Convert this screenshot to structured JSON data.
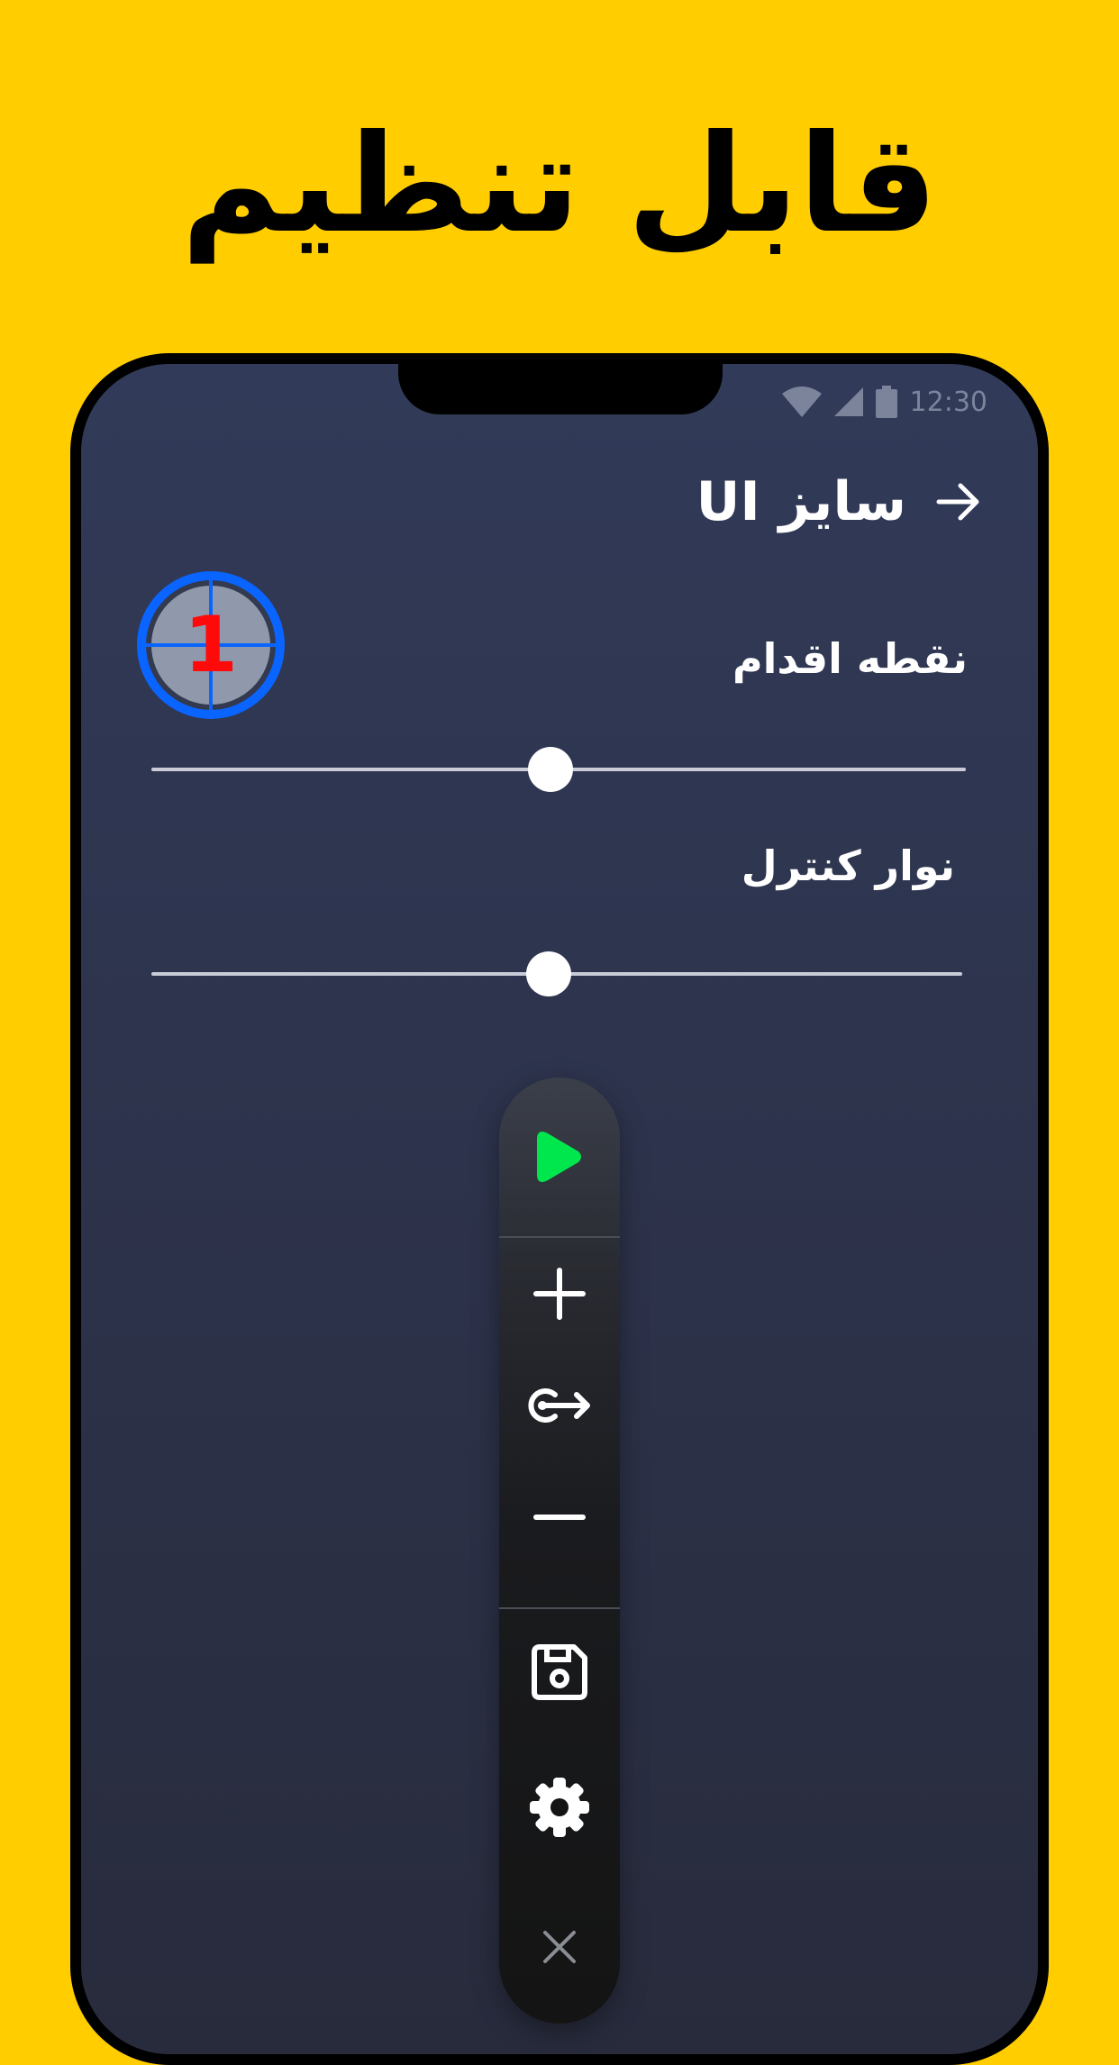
{
  "promo": {
    "headline": "قابل تنظیم"
  },
  "status_bar": {
    "time": "12:30",
    "icons": [
      "wifi-icon",
      "signal-icon",
      "battery-icon"
    ]
  },
  "header": {
    "title": "سایز UI",
    "back_icon": "arrow-right-icon"
  },
  "target_preview": {
    "number": "1"
  },
  "sliders": [
    {
      "label": "نقطه اقدام",
      "value_percent": 49
    },
    {
      "label": "نوار کنترل",
      "value_percent": 49
    }
  ],
  "toolbar": {
    "buttons": [
      "play-icon",
      "plus-icon",
      "swipe-icon",
      "minus-icon",
      "save-icon",
      "gear-icon",
      "close-icon"
    ]
  },
  "colors": {
    "background": "#FFCD00",
    "play": "#00E64D",
    "target_ring": "#0A64FF",
    "target_number": "#FF0A0A"
  }
}
